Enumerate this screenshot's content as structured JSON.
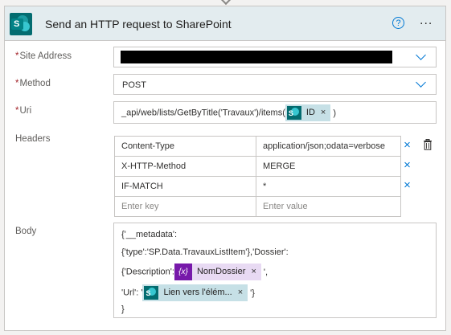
{
  "action": {
    "title": "Send an HTTP request to SharePoint",
    "help_icon": "?",
    "more_icon": "..."
  },
  "fields": {
    "site_address": {
      "label": "Site Address",
      "required_mark": "*"
    },
    "method": {
      "label": "Method",
      "required_mark": "*",
      "value": "POST"
    },
    "uri": {
      "label": "Uri",
      "required_mark": "*",
      "prefix": "_api/web/lists/GetByTitle('Travaux')/items(",
      "token": "ID",
      "suffix": ")"
    },
    "headers": {
      "label": "Headers",
      "rows": [
        {
          "key": "Content-Type",
          "value": "application/json;odata=verbose"
        },
        {
          "key": "X-HTTP-Method",
          "value": "MERGE"
        },
        {
          "key": "IF-MATCH",
          "value": "*"
        }
      ],
      "key_placeholder": "Enter key",
      "value_placeholder": "Enter value"
    },
    "body": {
      "label": "Body",
      "line1": "{'__metadata':",
      "line2": "{'type':'SP.Data.TravauxListItem'},'Dossier':",
      "line3_prefix": "{'Description':",
      "line3_token": "NomDossier",
      "line3_suffix": "',",
      "line4_prefix": "'Url': '",
      "line4_token": "Lien vers l'élém...",
      "line4_suffix": "'}",
      "line5": "}"
    }
  },
  "icons": {
    "sharepoint": "sharepoint-icon",
    "variable_symbol": "{x}",
    "remove": "×"
  },
  "colors": {
    "header_bg": "#e3ecef",
    "sharepoint": "#036c70",
    "token_sp_bg": "#c6e0e6",
    "token_var_bg": "#e8daf3",
    "variable": "#7719aa",
    "accent": "#0078d4",
    "required": "#a4262c"
  }
}
